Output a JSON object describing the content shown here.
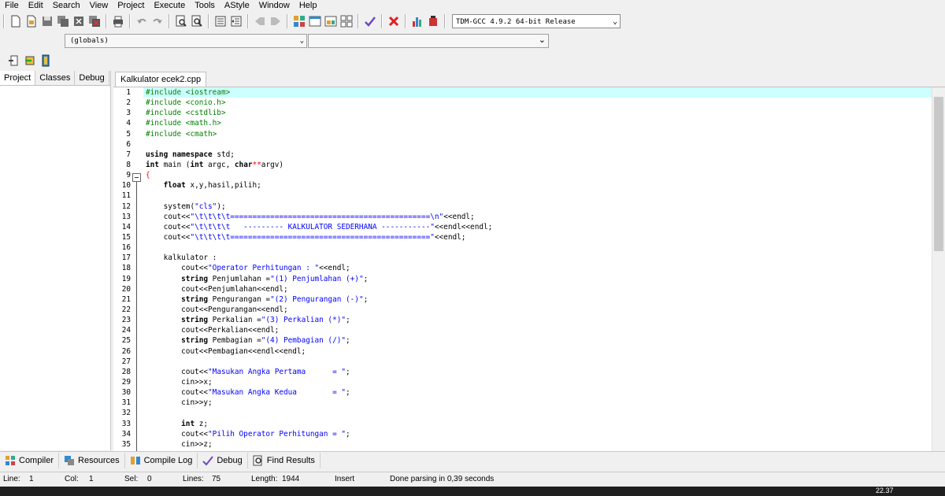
{
  "menu": [
    "File",
    "Edit",
    "Search",
    "View",
    "Project",
    "Execute",
    "Tools",
    "AStyle",
    "Window",
    "Help"
  ],
  "compiler": "TDM-GCC 4.9.2 64-bit Release",
  "globals": "(globals)",
  "side_tabs": [
    "Project",
    "Classes",
    "Debug"
  ],
  "file_tab": "Kalkulator ecek2.cpp",
  "bottom_tabs": [
    "Compiler",
    "Resources",
    "Compile Log",
    "Debug",
    "Find Results"
  ],
  "status": {
    "line_label": "Line:",
    "line_value": "1",
    "col_label": "Col:",
    "col_value": "1",
    "sel_label": "Sel:",
    "sel_value": "0",
    "lines_label": "Lines:",
    "lines_value": "75",
    "length_label": "Length:",
    "length_value": "1944",
    "mode": "Insert",
    "message": "Done parsing in 0,39 seconds"
  },
  "clock": "22.37",
  "code_lines": [
    {
      "n": "1",
      "t": "#include <iostream>"
    },
    {
      "n": "2",
      "t": "#include <conio.h>"
    },
    {
      "n": "3",
      "t": "#include <cstdlib>"
    },
    {
      "n": "4",
      "t": "#include <math.h>"
    },
    {
      "n": "5",
      "t": "#include <cmath>"
    },
    {
      "n": "6",
      "t": ""
    },
    {
      "n": "7",
      "t": "using namespace std;"
    },
    {
      "n": "8",
      "t": "int main (int argc, char**argv)"
    },
    {
      "n": "9",
      "t": "{"
    },
    {
      "n": "10",
      "t": "    float x,y,hasil,pilih;"
    },
    {
      "n": "11",
      "t": ""
    },
    {
      "n": "12",
      "t": "    system(\"cls\");"
    },
    {
      "n": "13",
      "t": "    cout<<\"\\t\\t\\t\\t=============================================\\n\"<<endl;"
    },
    {
      "n": "14",
      "t": "    cout<<\"\\t\\t\\t\\t   --------- KALKULATOR SEDERHANA -----------\"<<endl<<endl;"
    },
    {
      "n": "15",
      "t": "    cout<<\"\\t\\t\\t\\t=============================================\"<<endl;"
    },
    {
      "n": "16",
      "t": ""
    },
    {
      "n": "17",
      "t": "    kalkulator :"
    },
    {
      "n": "18",
      "t": "        cout<<\"Operator Perhitungan : \"<<endl;"
    },
    {
      "n": "19",
      "t": "        string Penjumlahan =\"(1) Penjumlahan (+)\";"
    },
    {
      "n": "20",
      "t": "        cout<<Penjumlahan<<endl;"
    },
    {
      "n": "21",
      "t": "        string Pengurangan =\"(2) Pengurangan (-)\";"
    },
    {
      "n": "22",
      "t": "        cout<<Pengurangan<<endl;"
    },
    {
      "n": "23",
      "t": "        string Perkalian =\"(3) Perkalian (*)\";"
    },
    {
      "n": "24",
      "t": "        cout<<Perkalian<<endl;"
    },
    {
      "n": "25",
      "t": "        string Pembagian =\"(4) Pembagian (/)\";"
    },
    {
      "n": "26",
      "t": "        cout<<Pembagian<<endl<<endl;"
    },
    {
      "n": "27",
      "t": ""
    },
    {
      "n": "28",
      "t": "        cout<<\"Masukan Angka Pertama      = \";"
    },
    {
      "n": "29",
      "t": "        cin>>x;"
    },
    {
      "n": "30",
      "t": "        cout<<\"Masukan Angka Kedua        = \";"
    },
    {
      "n": "31",
      "t": "        cin>>y;"
    },
    {
      "n": "32",
      "t": ""
    },
    {
      "n": "33",
      "t": "        int z;"
    },
    {
      "n": "34",
      "t": "        cout<<\"Pilih Operator Perhitungan = \";"
    },
    {
      "n": "35",
      "t": "        cin>>z;"
    }
  ]
}
